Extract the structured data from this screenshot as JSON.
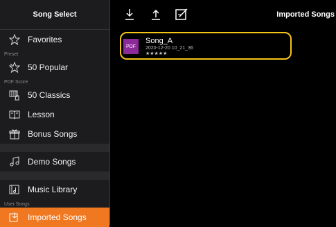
{
  "sidebar": {
    "header": "Song Select",
    "favorites": "Favorites",
    "section_preset": "Preset",
    "popular": "50 Popular",
    "section_pdf": "PDF Score",
    "classics": "50 Classics",
    "lesson": "Lesson",
    "bonus": "Bonus Songs",
    "demo": "Demo Songs",
    "music_library": "Music Library",
    "section_user": "User Songs",
    "imported": "Imported Songs"
  },
  "toolbar": {
    "title": "Imported Songs",
    "download_icon": "download-icon",
    "upload_icon": "upload-icon",
    "edit_icon": "edit-icon"
  },
  "file": {
    "badge": "PDF",
    "name": "Song_A",
    "meta": "2020-12-20 10_21_36",
    "rating": "★★★★★"
  },
  "colors": {
    "accent": "#f07820",
    "highlight": "#f5c518",
    "pdf_badge": "#8c2a9a"
  }
}
